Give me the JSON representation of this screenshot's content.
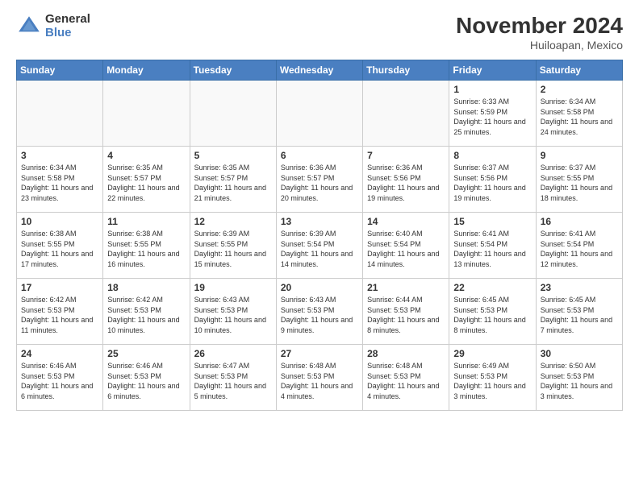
{
  "header": {
    "logo_general": "General",
    "logo_blue": "Blue",
    "month_title": "November 2024",
    "subtitle": "Huiloapan, Mexico"
  },
  "days_of_week": [
    "Sunday",
    "Monday",
    "Tuesday",
    "Wednesday",
    "Thursday",
    "Friday",
    "Saturday"
  ],
  "weeks": [
    [
      {
        "day": "",
        "empty": true
      },
      {
        "day": "",
        "empty": true
      },
      {
        "day": "",
        "empty": true
      },
      {
        "day": "",
        "empty": true
      },
      {
        "day": "",
        "empty": true
      },
      {
        "day": "1",
        "sunrise": "Sunrise: 6:33 AM",
        "sunset": "Sunset: 5:59 PM",
        "daylight": "Daylight: 11 hours and 25 minutes."
      },
      {
        "day": "2",
        "sunrise": "Sunrise: 6:34 AM",
        "sunset": "Sunset: 5:58 PM",
        "daylight": "Daylight: 11 hours and 24 minutes."
      }
    ],
    [
      {
        "day": "3",
        "sunrise": "Sunrise: 6:34 AM",
        "sunset": "Sunset: 5:58 PM",
        "daylight": "Daylight: 11 hours and 23 minutes."
      },
      {
        "day": "4",
        "sunrise": "Sunrise: 6:35 AM",
        "sunset": "Sunset: 5:57 PM",
        "daylight": "Daylight: 11 hours and 22 minutes."
      },
      {
        "day": "5",
        "sunrise": "Sunrise: 6:35 AM",
        "sunset": "Sunset: 5:57 PM",
        "daylight": "Daylight: 11 hours and 21 minutes."
      },
      {
        "day": "6",
        "sunrise": "Sunrise: 6:36 AM",
        "sunset": "Sunset: 5:57 PM",
        "daylight": "Daylight: 11 hours and 20 minutes."
      },
      {
        "day": "7",
        "sunrise": "Sunrise: 6:36 AM",
        "sunset": "Sunset: 5:56 PM",
        "daylight": "Daylight: 11 hours and 19 minutes."
      },
      {
        "day": "8",
        "sunrise": "Sunrise: 6:37 AM",
        "sunset": "Sunset: 5:56 PM",
        "daylight": "Daylight: 11 hours and 19 minutes."
      },
      {
        "day": "9",
        "sunrise": "Sunrise: 6:37 AM",
        "sunset": "Sunset: 5:55 PM",
        "daylight": "Daylight: 11 hours and 18 minutes."
      }
    ],
    [
      {
        "day": "10",
        "sunrise": "Sunrise: 6:38 AM",
        "sunset": "Sunset: 5:55 PM",
        "daylight": "Daylight: 11 hours and 17 minutes."
      },
      {
        "day": "11",
        "sunrise": "Sunrise: 6:38 AM",
        "sunset": "Sunset: 5:55 PM",
        "daylight": "Daylight: 11 hours and 16 minutes."
      },
      {
        "day": "12",
        "sunrise": "Sunrise: 6:39 AM",
        "sunset": "Sunset: 5:55 PM",
        "daylight": "Daylight: 11 hours and 15 minutes."
      },
      {
        "day": "13",
        "sunrise": "Sunrise: 6:39 AM",
        "sunset": "Sunset: 5:54 PM",
        "daylight": "Daylight: 11 hours and 14 minutes."
      },
      {
        "day": "14",
        "sunrise": "Sunrise: 6:40 AM",
        "sunset": "Sunset: 5:54 PM",
        "daylight": "Daylight: 11 hours and 14 minutes."
      },
      {
        "day": "15",
        "sunrise": "Sunrise: 6:41 AM",
        "sunset": "Sunset: 5:54 PM",
        "daylight": "Daylight: 11 hours and 13 minutes."
      },
      {
        "day": "16",
        "sunrise": "Sunrise: 6:41 AM",
        "sunset": "Sunset: 5:54 PM",
        "daylight": "Daylight: 11 hours and 12 minutes."
      }
    ],
    [
      {
        "day": "17",
        "sunrise": "Sunrise: 6:42 AM",
        "sunset": "Sunset: 5:53 PM",
        "daylight": "Daylight: 11 hours and 11 minutes."
      },
      {
        "day": "18",
        "sunrise": "Sunrise: 6:42 AM",
        "sunset": "Sunset: 5:53 PM",
        "daylight": "Daylight: 11 hours and 10 minutes."
      },
      {
        "day": "19",
        "sunrise": "Sunrise: 6:43 AM",
        "sunset": "Sunset: 5:53 PM",
        "daylight": "Daylight: 11 hours and 10 minutes."
      },
      {
        "day": "20",
        "sunrise": "Sunrise: 6:43 AM",
        "sunset": "Sunset: 5:53 PM",
        "daylight": "Daylight: 11 hours and 9 minutes."
      },
      {
        "day": "21",
        "sunrise": "Sunrise: 6:44 AM",
        "sunset": "Sunset: 5:53 PM",
        "daylight": "Daylight: 11 hours and 8 minutes."
      },
      {
        "day": "22",
        "sunrise": "Sunrise: 6:45 AM",
        "sunset": "Sunset: 5:53 PM",
        "daylight": "Daylight: 11 hours and 8 minutes."
      },
      {
        "day": "23",
        "sunrise": "Sunrise: 6:45 AM",
        "sunset": "Sunset: 5:53 PM",
        "daylight": "Daylight: 11 hours and 7 minutes."
      }
    ],
    [
      {
        "day": "24",
        "sunrise": "Sunrise: 6:46 AM",
        "sunset": "Sunset: 5:53 PM",
        "daylight": "Daylight: 11 hours and 6 minutes."
      },
      {
        "day": "25",
        "sunrise": "Sunrise: 6:46 AM",
        "sunset": "Sunset: 5:53 PM",
        "daylight": "Daylight: 11 hours and 6 minutes."
      },
      {
        "day": "26",
        "sunrise": "Sunrise: 6:47 AM",
        "sunset": "Sunset: 5:53 PM",
        "daylight": "Daylight: 11 hours and 5 minutes."
      },
      {
        "day": "27",
        "sunrise": "Sunrise: 6:48 AM",
        "sunset": "Sunset: 5:53 PM",
        "daylight": "Daylight: 11 hours and 4 minutes."
      },
      {
        "day": "28",
        "sunrise": "Sunrise: 6:48 AM",
        "sunset": "Sunset: 5:53 PM",
        "daylight": "Daylight: 11 hours and 4 minutes."
      },
      {
        "day": "29",
        "sunrise": "Sunrise: 6:49 AM",
        "sunset": "Sunset: 5:53 PM",
        "daylight": "Daylight: 11 hours and 3 minutes."
      },
      {
        "day": "30",
        "sunrise": "Sunrise: 6:50 AM",
        "sunset": "Sunset: 5:53 PM",
        "daylight": "Daylight: 11 hours and 3 minutes."
      }
    ]
  ]
}
